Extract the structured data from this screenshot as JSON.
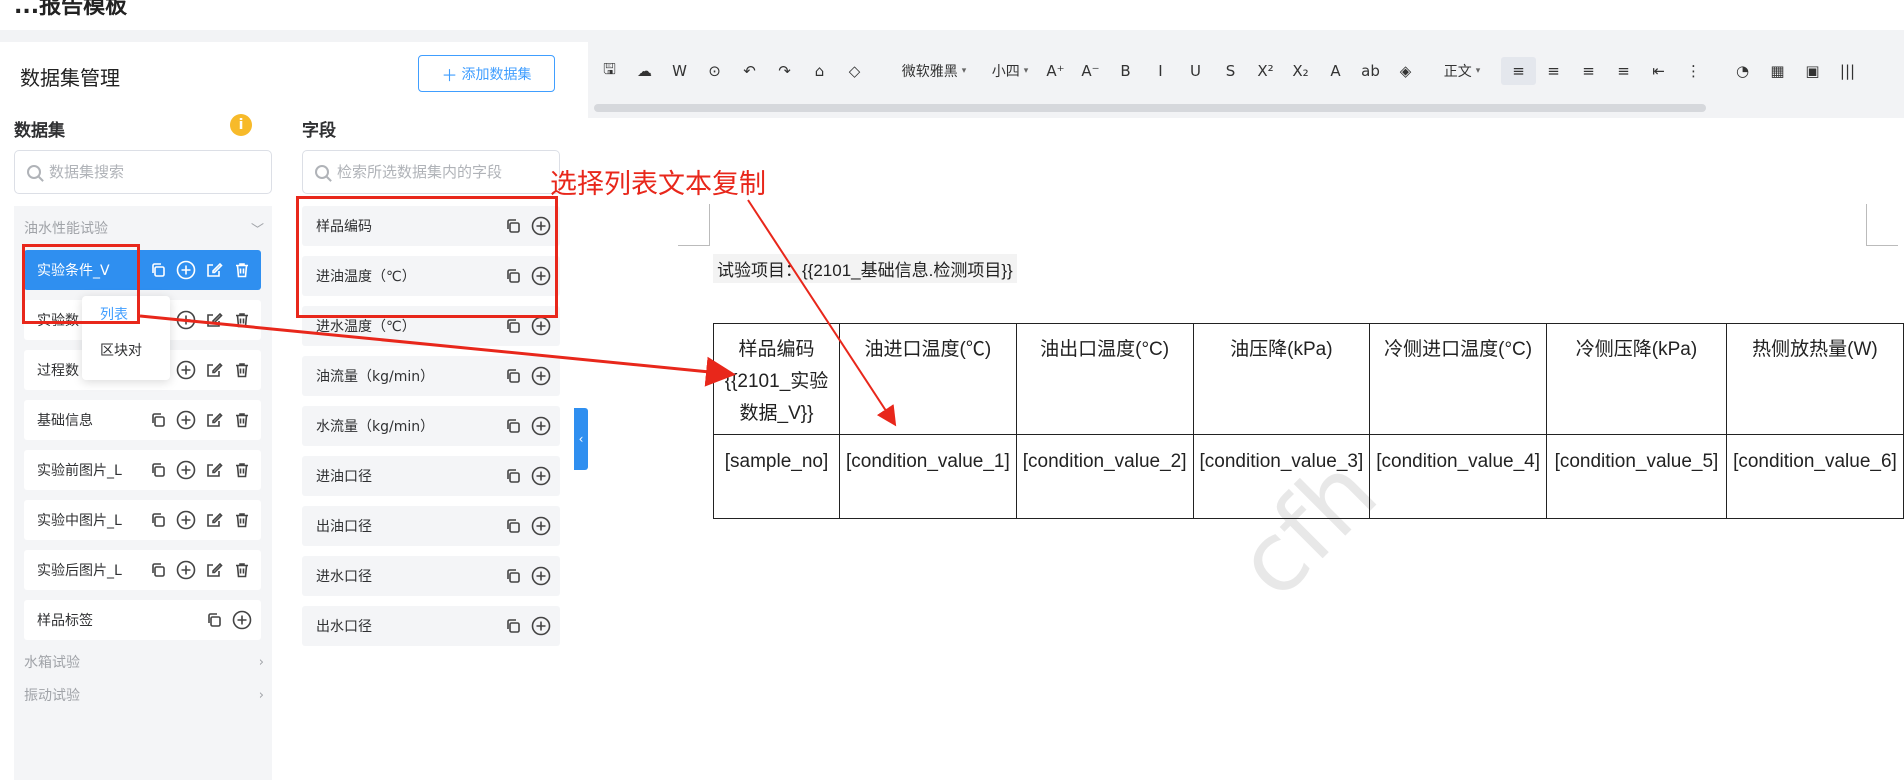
{
  "app": {
    "title": "...报告模板"
  },
  "panel": {
    "title": "数据集管理",
    "add_button": "添加数据集",
    "dataset_header": "数据集",
    "info_icon": "i",
    "dataset_search_placeholder": "数据集搜索",
    "field_header": "字段",
    "field_search_placeholder": "检索所选数据集内的字段"
  },
  "groups": [
    {
      "name": "油水性能试验",
      "expanded": true
    },
    {
      "name": "水箱试验",
      "expanded": false
    },
    {
      "name": "振动试验",
      "expanded": false
    }
  ],
  "datasets": [
    {
      "label": "实验条件_V",
      "active": true
    },
    {
      "label": "实验数"
    },
    {
      "label": "过程数"
    },
    {
      "label": "基础信息"
    },
    {
      "label": "实验前图片_L"
    },
    {
      "label": "实验中图片_L"
    },
    {
      "label": "实验后图片_L"
    },
    {
      "label": "样品标签"
    }
  ],
  "popup_menu": [
    "列表",
    "区块对"
  ],
  "fields": [
    "样品编码",
    "进油温度（℃）",
    "进水温度（℃）",
    "油流量（kg/min）",
    "水流量（kg/min）",
    "进油口径",
    "出油口径",
    "进水口径",
    "出水口径"
  ],
  "toolbar": {
    "font_family": "微软雅黑",
    "font_size": "小四",
    "paragraph_style": "正文",
    "icons": [
      "save-icon",
      "cloud-upload-icon",
      "word-export-icon",
      "preview-icon",
      "undo-icon",
      "redo-icon",
      "format-painter-icon",
      "eraser-icon"
    ],
    "buttons": [
      "A⁺",
      "A⁻",
      "B",
      "I",
      "U",
      "S",
      "X²",
      "X₂",
      "A",
      "ab",
      "◈"
    ],
    "align": [
      "≡",
      "≡",
      "≡",
      "≡",
      "⇤",
      "⋮"
    ],
    "insert": [
      "◔",
      "▦",
      "▣",
      "|||"
    ]
  },
  "document": {
    "experiment_line": "试验项目：{{2101_基础信息.检测项目}}",
    "table_header": [
      "样品编码{{2101_实验数据_V}}",
      "油进口温度(℃)",
      "油出口温度(°C)",
      "油压降(kPa)",
      "冷侧进口温度(°C)",
      "冷侧压降(kPa)",
      "热侧放热量(W)"
    ],
    "table_row": [
      "[sample_no]",
      "[condition_value_1]",
      "[condition_value_2]",
      "[condition_value_3]",
      "[condition_value_4]",
      "[condition_value_5]",
      "[condition_value_6]"
    ],
    "watermark": "cfh"
  },
  "annotation": {
    "text": "选择列表文本复制",
    "color": "#e8271b"
  },
  "colors": {
    "accent": "#2f8ff0",
    "annotation": "#e8271b",
    "info": "#f7ba2a"
  }
}
